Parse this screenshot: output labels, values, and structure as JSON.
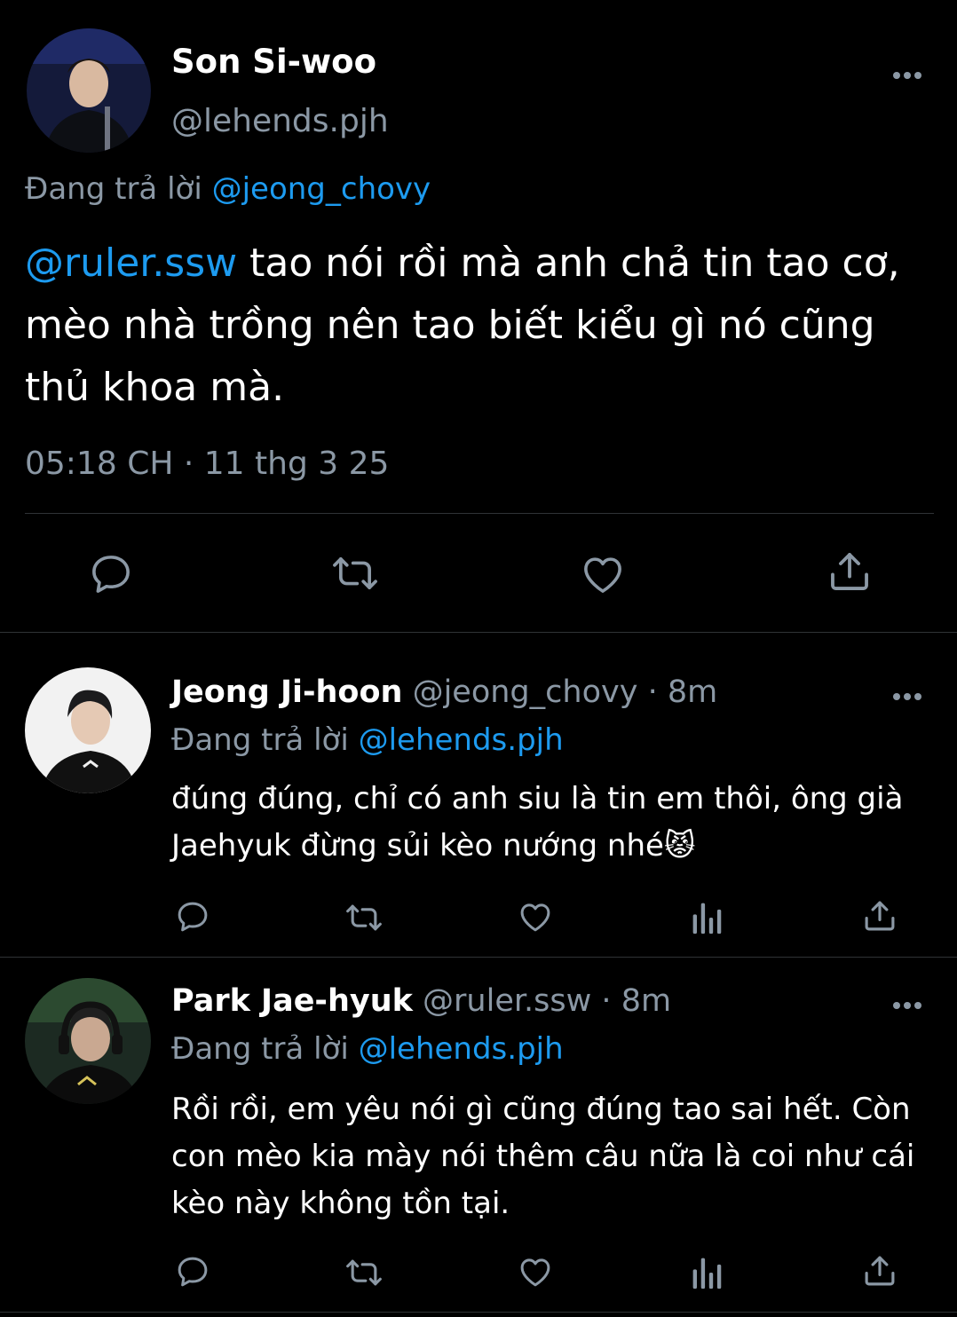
{
  "main_tweet": {
    "name": "Son Si-woo",
    "handle": "@lehends.pjh",
    "replying_prefix": "Đang trả lời",
    "replying_to": "@jeong_chovy",
    "mention": "@ruler.ssw",
    "body": " tao nói rồi mà anh chả tin tao cơ, mèo nhà trồng nên tao biết kiểu gì nó cũng thủ khoa mà.",
    "time": "05:18 CH",
    "separator": "·",
    "date": "11 thg 3 25"
  },
  "replies": [
    {
      "name": "Jeong Ji-hoon",
      "handle": "@jeong_chovy",
      "separator": "·",
      "age": "8m",
      "replying_prefix": "Đang trả lời",
      "replying_to": "@lehends.pjh",
      "body": "đúng đúng, chỉ có anh siu là tin em thôi, ông già Jaehyuk đừng sủi kèo nướng nhé😾"
    },
    {
      "name": "Park Jae-hyuk",
      "handle": "@ruler.ssw",
      "separator": "·",
      "age": "8m",
      "replying_prefix": "Đang trả lời",
      "replying_to": "@lehends.pjh",
      "body": "Rồi rồi, em yêu nói gì cũng đúng tao sai hết. Còn con mèo kia mày nói thêm câu nữa là coi như cái kèo này không tồn tại."
    }
  ],
  "icons": [
    "reply-icon",
    "retweet-icon",
    "like-icon",
    "share-icon",
    "analytics-icon",
    "more-icon"
  ],
  "colors": {
    "background": "#000000",
    "mention": "#1d9bf0",
    "secondary": "#8b98a5",
    "divider": "#2f3336"
  }
}
